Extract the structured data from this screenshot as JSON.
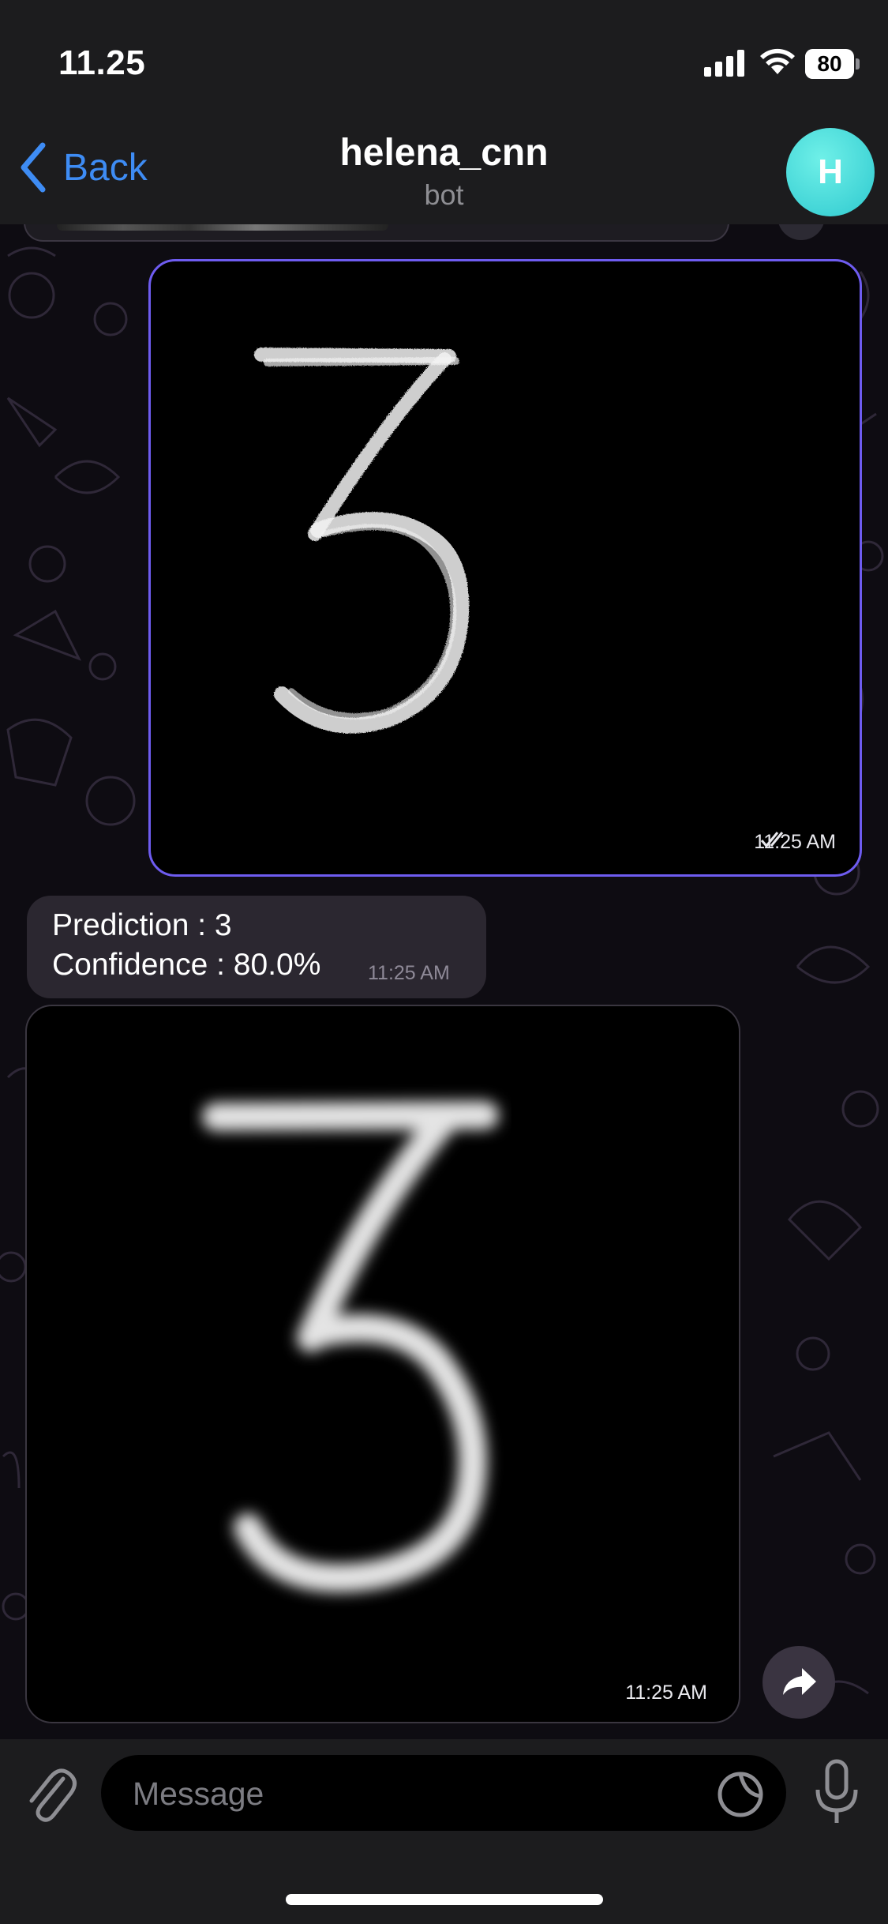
{
  "status_bar": {
    "time": "11.25",
    "battery_percent": "80",
    "battery_level": 0.8
  },
  "header": {
    "back_label": "Back",
    "title": "helena_cnn",
    "subtitle": "bot",
    "avatar_letter": "H"
  },
  "messages": {
    "outgoing_photo": {
      "time": "11:25 AM",
      "status_icon": "double-check-icon"
    },
    "bot_reply": {
      "prediction_line": "Prediction : 3",
      "confidence_line": "Confidence : 80.0%",
      "time": "11:25 AM"
    },
    "bot_photo": {
      "time": "11:25 AM"
    }
  },
  "input": {
    "placeholder": "Message"
  },
  "icons": {
    "back": "chevron-left-icon",
    "attach": "paperclip-icon",
    "sticker": "sticker-icon",
    "mic": "microphone-icon",
    "forward": "forward-arrow-icon",
    "signal": "cellular-signal-icon",
    "wifi": "wifi-icon"
  },
  "colors": {
    "accent": "#3e8cf4",
    "outgoing_border": "#6e5cf0",
    "avatar": "#3dd6d8",
    "bubble_in": "#2b2730"
  }
}
